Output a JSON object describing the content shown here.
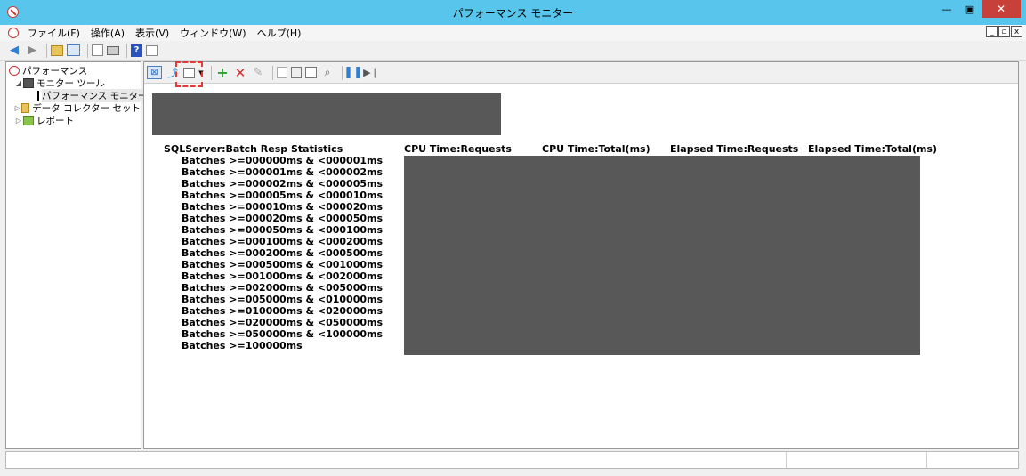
{
  "window": {
    "title": "パフォーマンス モニター"
  },
  "title_buttons": {
    "minimize": "—",
    "restore": "▣",
    "close": "✕"
  },
  "menu": [
    {
      "label": "ファイル(F)"
    },
    {
      "label": "操作(A)"
    },
    {
      "label": "表示(V)"
    },
    {
      "label": "ウィンドウ(W)"
    },
    {
      "label": "ヘルプ(H)"
    }
  ],
  "mdi_buttons": {
    "minimize": "_",
    "restore": "▫",
    "close": "x"
  },
  "tree": {
    "root": "パフォーマンス",
    "monitor_tools": "モニター ツール",
    "perf_monitor": "パフォーマンス モニター",
    "data_collector": "データ コレクター セット",
    "reports": "レポート"
  },
  "counter_panel": {
    "object_name": "SQLServer:Batch Resp Statistics",
    "columns": [
      "CPU Time:Requests",
      "CPU Time:Total(ms)",
      "Elapsed Time:Requests",
      "Elapsed Time:Total(ms)"
    ],
    "instances": [
      "Batches >=000000ms & <000001ms",
      "Batches >=000001ms & <000002ms",
      "Batches >=000002ms & <000005ms",
      "Batches >=000005ms & <000010ms",
      "Batches >=000010ms & <000020ms",
      "Batches >=000020ms & <000050ms",
      "Batches >=000050ms & <000100ms",
      "Batches >=000100ms & <000200ms",
      "Batches >=000200ms & <000500ms",
      "Batches >=000500ms & <001000ms",
      "Batches >=001000ms & <002000ms",
      "Batches >=002000ms & <005000ms",
      "Batches >=005000ms & <010000ms",
      "Batches >=010000ms & <020000ms",
      "Batches >=020000ms & <050000ms",
      "Batches >=050000ms & <100000ms",
      "Batches >=100000ms"
    ]
  },
  "colors": {
    "titlebar": "#58c6ec",
    "close_button": "#c7403a",
    "redaction": "#585858",
    "highlight_box": "#e53935"
  }
}
